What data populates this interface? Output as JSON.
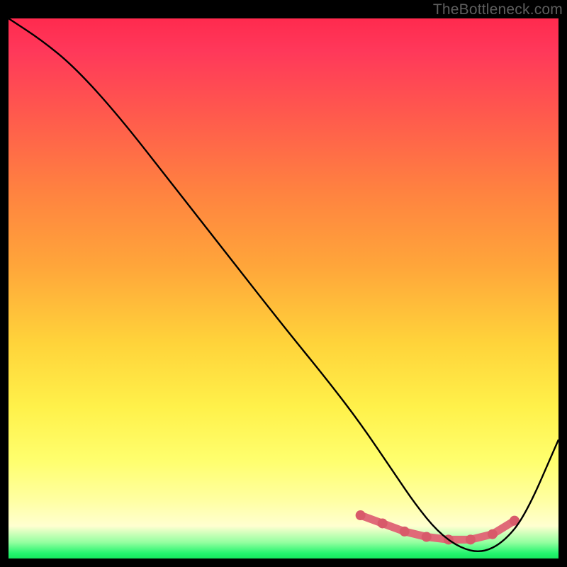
{
  "watermark": "TheBottleneck.com",
  "chart_data": {
    "type": "line",
    "title": "",
    "xlabel": "",
    "ylabel": "",
    "xlim": [
      0,
      100
    ],
    "ylim": [
      0,
      100
    ],
    "series": [
      {
        "name": "bottleneck-curve",
        "x": [
          0,
          6,
          12,
          20,
          30,
          40,
          50,
          58,
          64,
          70,
          74,
          78,
          82,
          86,
          90,
          94,
          100
        ],
        "values": [
          100,
          96,
          91,
          82,
          69,
          56,
          43,
          33,
          25,
          16,
          10,
          5,
          2,
          1,
          3,
          8,
          22
        ]
      }
    ],
    "highlight_band": {
      "name": "optimal-zone",
      "x": [
        64,
        68,
        72,
        76,
        80,
        84,
        88,
        92
      ],
      "values": [
        8,
        6.5,
        5,
        4,
        3.5,
        3.5,
        4.5,
        7
      ]
    },
    "colors": {
      "curve": "#000000",
      "highlight": "#e06a78",
      "highlight_dot": "#d85a6a"
    }
  }
}
